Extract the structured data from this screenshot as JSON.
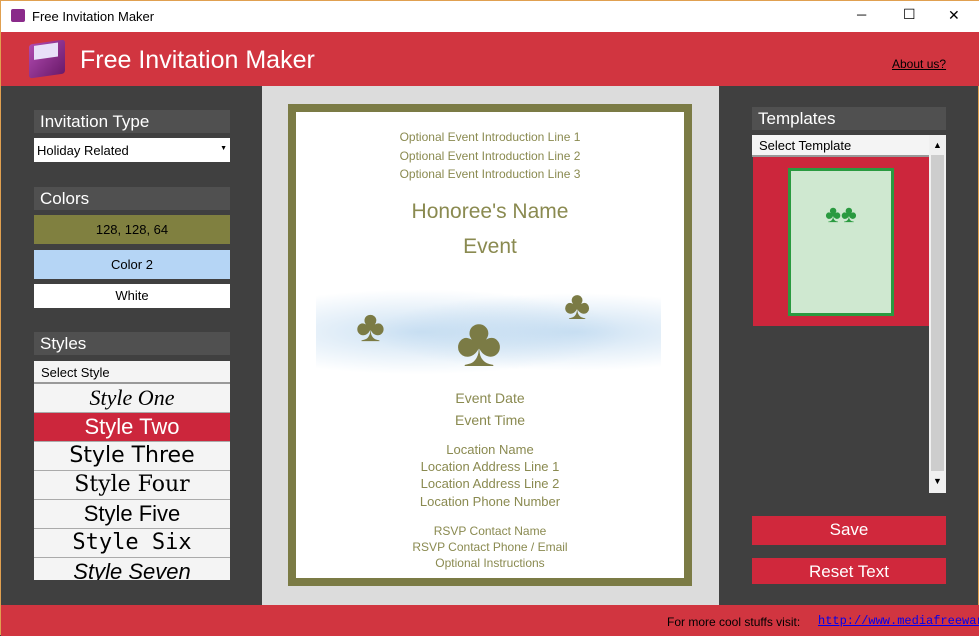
{
  "window": {
    "title": "Free Invitation Maker",
    "min": "─",
    "max": "☐",
    "close": "✕"
  },
  "header": {
    "title": "Free Invitation Maker",
    "about": "About us?"
  },
  "left": {
    "type_label": "Invitation Type",
    "type_value": "Holiday Related",
    "colors_label": "Colors",
    "color1": "128, 128, 64",
    "color2": "Color 2",
    "color3": "White",
    "color1_hex": "#808040",
    "color2_hex": "#b5d5f5",
    "color3_hex": "#ffffff",
    "styles_label": "Styles",
    "styles_header": "Select Style",
    "styles": [
      "Style One",
      "Style Two",
      "Style Three",
      "Style Four",
      "Style Five",
      "Style Six",
      "Style Seven"
    ]
  },
  "card": {
    "intro": [
      "Optional Event Introduction Line 1",
      "Optional Event Introduction Line 2",
      "Optional Event Introduction Line 3"
    ],
    "honoree": "Honoree's Name",
    "event": "Event",
    "date": "Event Date",
    "time": "Event Time",
    "location": [
      "Location Name",
      "Location Address Line 1",
      "Location Address Line 2",
      "Location Phone Number"
    ],
    "rsvp": [
      "RSVP Contact Name",
      "RSVP Contact Phone / Email",
      "Optional Instructions"
    ]
  },
  "right": {
    "templates_label": "Templates",
    "templates_header": "Select Template",
    "save": "Save",
    "reset": "Reset Text"
  },
  "footer": {
    "text": "For more cool stuffs visit:",
    "link": "http://www.mediafreeware.co"
  }
}
